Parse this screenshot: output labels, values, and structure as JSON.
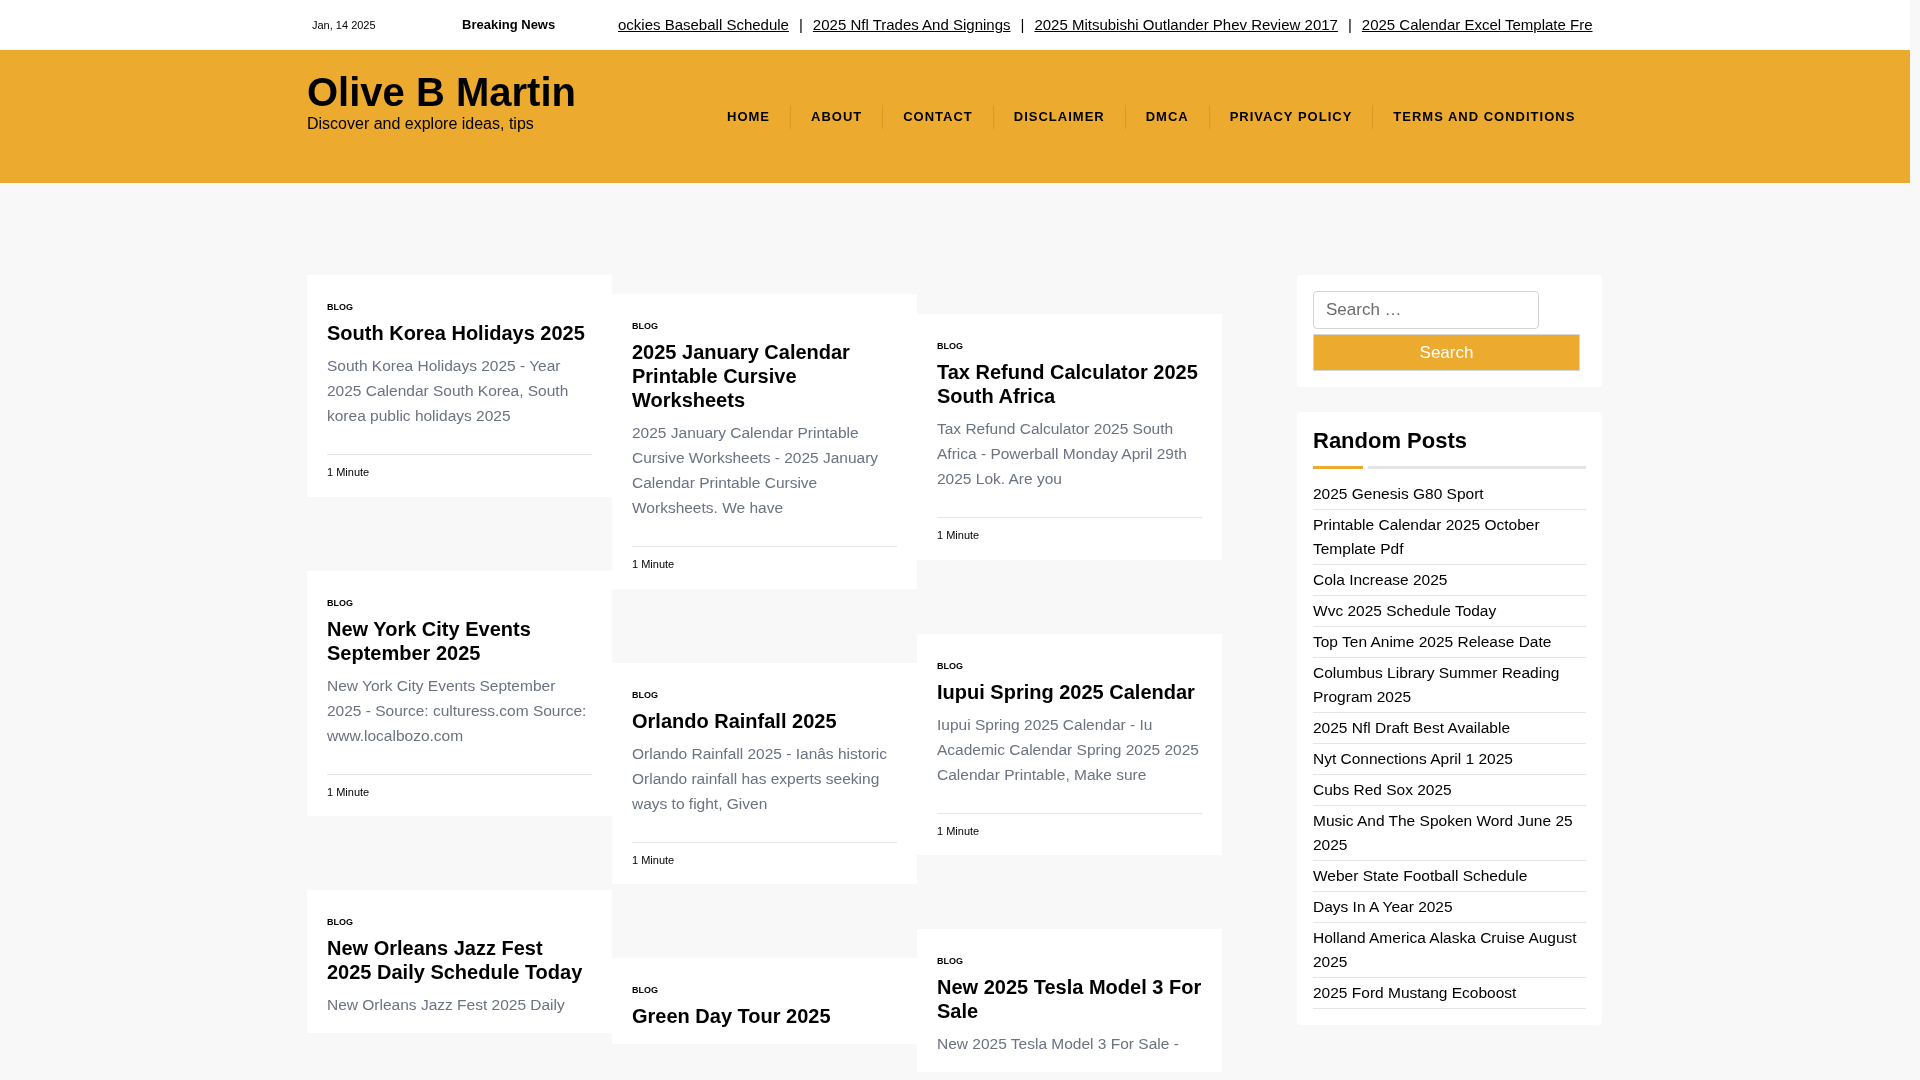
{
  "top_bar": {
    "date": "Jan, 14 2025",
    "breaking_label": "Breaking News",
    "ticker": [
      "ockies Baseball Schedule",
      "2025 Nfl Trades And Signings",
      "2025 Mitsubishi Outlander Phev Review 2017",
      "2025 Calendar Excel Template Fre"
    ],
    "separator": "|"
  },
  "header": {
    "site_title": "Olive B Martin",
    "tagline": "Discover and explore ideas, tips",
    "nav": [
      "HOME",
      "ABOUT",
      "CONTACT",
      "DISCLAIMER",
      "DMCA",
      "PRIVACY POLICY",
      "TERMS AND CONDITIONS"
    ]
  },
  "posts": [
    [
      {
        "category": "BLOG",
        "title": "South Korea Holidays 2025",
        "excerpt": "South Korea Holidays 2025 - Year 2025 Calendar South Korea, South korea public holidays 2025",
        "read_time": "1 Minute"
      },
      {
        "category": "BLOG",
        "title": "New York City Events September 2025",
        "excerpt": "New York City Events September 2025 - Source: culturess.com Source: www.localbozo.com",
        "read_time": "1 Minute"
      },
      {
        "category": "BLOG",
        "title": "New Orleans Jazz Fest 2025 Daily Schedule Today",
        "excerpt": "New Orleans Jazz Fest 2025 Daily"
      }
    ],
    [
      {
        "category": "BLOG",
        "title": "2025 January Calendar Printable Cursive Worksheets",
        "excerpt": "2025 January Calendar Printable Cursive Worksheets - 2025 January Calendar Printable Cursive Worksheets. We have",
        "read_time": "1 Minute"
      },
      {
        "category": "BLOG",
        "title": "Orlando Rainfall 2025",
        "excerpt": "Orlando Rainfall 2025 - Ianâs historic Orlando rainfall has experts seeking ways to fight, Given",
        "read_time": "1 Minute"
      },
      {
        "category": "BLOG",
        "title": "Green Day Tour 2025"
      }
    ],
    [
      {
        "category": "BLOG",
        "title": "Tax Refund Calculator 2025 South Africa",
        "excerpt": "Tax Refund Calculator 2025 South Africa - Powerball Monday April 29th 2025 Lok. Are you",
        "read_time": "1 Minute"
      },
      {
        "category": "BLOG",
        "title": "Iupui Spring 2025 Calendar",
        "excerpt": "Iupui Spring 2025 Calendar - Iu Academic Calendar Spring 2025 2025 Calendar Printable, Make sure",
        "read_time": "1 Minute"
      },
      {
        "category": "BLOG",
        "title": "New 2025 Tesla Model 3 For Sale",
        "excerpt": "New 2025 Tesla Model 3 For Sale -"
      }
    ]
  ],
  "sidebar": {
    "search": {
      "placeholder": "Search …",
      "button": "Search"
    },
    "random_posts": {
      "title": "Random Posts",
      "items": [
        "2025 Genesis G80 Sport",
        "Printable Calendar 2025 October Template Pdf",
        "Cola Increase 2025",
        "Wvc 2025 Schedule Today",
        "Top Ten Anime 2025 Release Date",
        "Columbus Library Summer Reading Program 2025",
        "2025 Nfl Draft Best Available",
        "Nyt Connections April 1 2025",
        "Cubs Red Sox 2025",
        "Music And The Spoken Word June 25 2025",
        "Weber State Football Schedule",
        "Days In A Year 2025",
        "Holland America Alaska Cruise August 2025",
        "2025 Ford Mustang Ecoboost"
      ]
    }
  }
}
